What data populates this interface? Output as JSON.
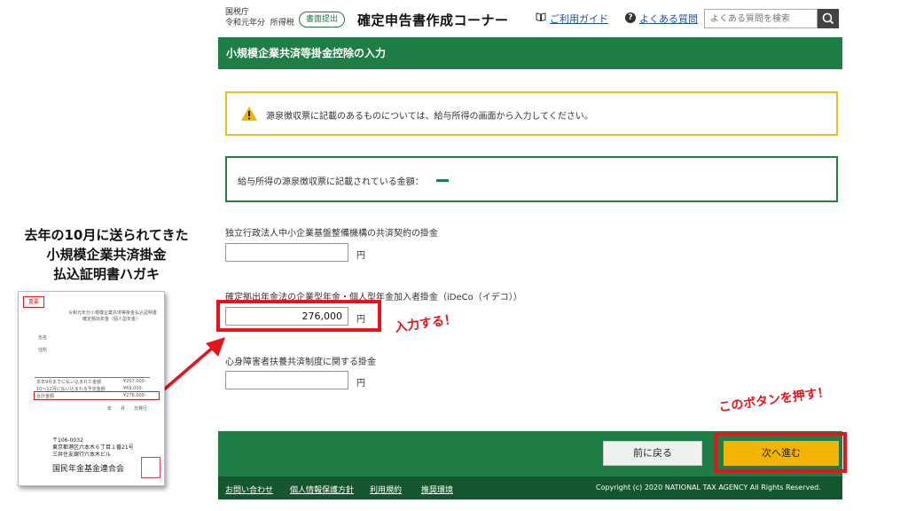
{
  "header": {
    "agency": "国税庁",
    "tax_year": "令和元年分",
    "tax_type": "所得税",
    "badge": "書面提出",
    "app_title": "確定申告書作成コーナー",
    "guide_link": "ご利用ガイド",
    "faq_link": "よくある質問",
    "search_placeholder": "よくある質問を検索"
  },
  "page_title": "小規模企業共済等掛金控除の入力",
  "notices": {
    "warning": "源泉徴収票に記載のあるものについては、給与所得の画面から入力してください。",
    "salary_label": "給与所得の源泉徴収票に記載されている金額：",
    "salary_value": "—"
  },
  "fields": [
    {
      "label": "独立行政法人中小企業基盤整備機構の共済契約の掛金",
      "value": "",
      "unit": "円"
    },
    {
      "label": "確定拠出年金法の企業型年金・個人型年金加入者掛金（iDeCo（イデコ））",
      "value": "276,000",
      "unit": "円"
    },
    {
      "label": "心身障害者扶養共済制度に関する掛金",
      "value": "",
      "unit": "円"
    }
  ],
  "buttons": {
    "back": "前に戻る",
    "next": "次へ進む"
  },
  "footer": {
    "links": [
      "お問い合わせ",
      "個人情報保護方針",
      "利用規約",
      "推奨環境"
    ],
    "copyright": "Copyright (c) 2020 NATIONAL TAX AGENCY All Rights Reserved."
  },
  "annotations": {
    "left_heading": [
      "去年の10月に送られてきた",
      "小規模企業共済掛金",
      "払込証明書ハガキ"
    ],
    "input_callout": "入力する！",
    "button_callout": "このボタンを押す！"
  },
  "postcard": {
    "badge": "重要",
    "title_line1": "令和元年分小規模企業共済等掛金払込証明書",
    "title_line2": "確定拠出年金（個人型年金）",
    "name_label": "氏名",
    "address_label": "住所",
    "row1_label": "本年9月までに払い込まれた金額",
    "row1_value": "¥207,000-",
    "row2_label": "10〜12月に払い込まれる予定金額",
    "row2_value": "¥69,000-",
    "total_label": "合計金額",
    "total_value": "¥276,000-",
    "date_line": "年　　月　　日発行",
    "postal": "〒106-0032",
    "address1": "東京都港区六本木６丁目１番21号",
    "address2": "三井住友銀行六本木ビル",
    "org": "国民年金基金連合会"
  },
  "colors": {
    "brand_green": "#1e7e46",
    "dark_green": "#14572f",
    "accent_yellow": "#f2b400",
    "annotation_red": "#e8121b",
    "warning_border": "#e5c21d"
  }
}
